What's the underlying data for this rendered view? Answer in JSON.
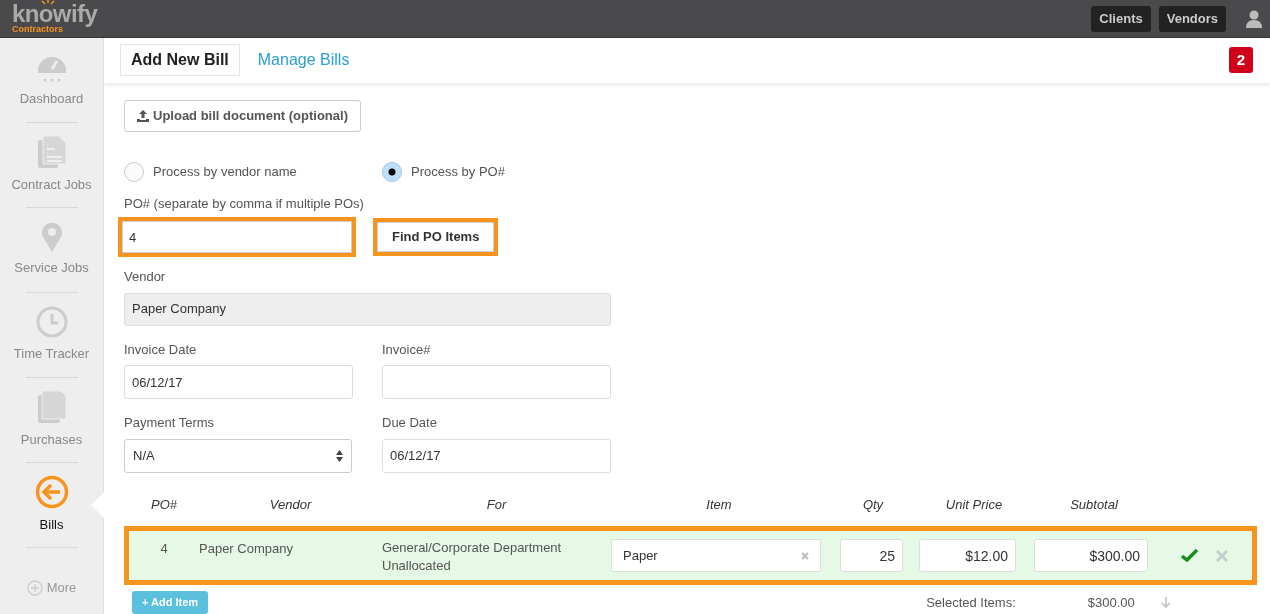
{
  "topbar": {
    "logo": "knowify",
    "logo_sub": "Contractors",
    "buttons": [
      "Clients",
      "Vendors"
    ]
  },
  "sidebar": {
    "items": [
      {
        "label": "Dashboard",
        "selected": false
      },
      {
        "label": "Contract Jobs",
        "selected": false
      },
      {
        "label": "Service Jobs",
        "selected": false
      },
      {
        "label": "Time Tracker",
        "selected": false
      },
      {
        "label": "Purchases",
        "selected": false
      },
      {
        "label": "Bills",
        "selected": true
      }
    ],
    "more": "More"
  },
  "tabs": [
    {
      "label": "Add New Bill",
      "selected": true
    },
    {
      "label": "Manage Bills",
      "selected": false
    }
  ],
  "notification_count": "2",
  "upload_button": "Upload bill document (optional)",
  "process_options": [
    {
      "label": "Process by vendor name",
      "selected": false
    },
    {
      "label": "Process by PO#",
      "selected": true
    }
  ],
  "po_field": {
    "label": "PO# (separate by comma if multiple POs)",
    "value": "4",
    "highlighted": true
  },
  "find_button": {
    "label": "Find PO Items",
    "highlighted": true
  },
  "vendor_field": {
    "label": "Vendor",
    "value": "Paper Company",
    "disabled": true
  },
  "invoice_date": {
    "label": "Invoice Date",
    "value": "06/12/17"
  },
  "invoice_number": {
    "label": "Invoice#"
  },
  "payment_terms": {
    "label": "Payment Terms",
    "value": "N/A"
  },
  "due_date": {
    "label": "Due Date",
    "value": "06/12/17"
  },
  "table": {
    "columns": [
      "PO#",
      "Vendor",
      "For",
      "Item",
      "Qty",
      "Unit Price",
      "Subtotal"
    ],
    "rows": [
      {
        "po": "4",
        "vendor": "Paper Company",
        "for": [
          "General/Corporate Department",
          "Unallocated"
        ],
        "item": "Paper",
        "qty": "25",
        "unit_price": "$12.00",
        "subtotal": "$300.00",
        "selected": true,
        "highlighted": true
      }
    ]
  },
  "add_item_button": "+ Add Item",
  "selected_items_label": "Selected Items:",
  "selected_items_total": "$300.00"
}
